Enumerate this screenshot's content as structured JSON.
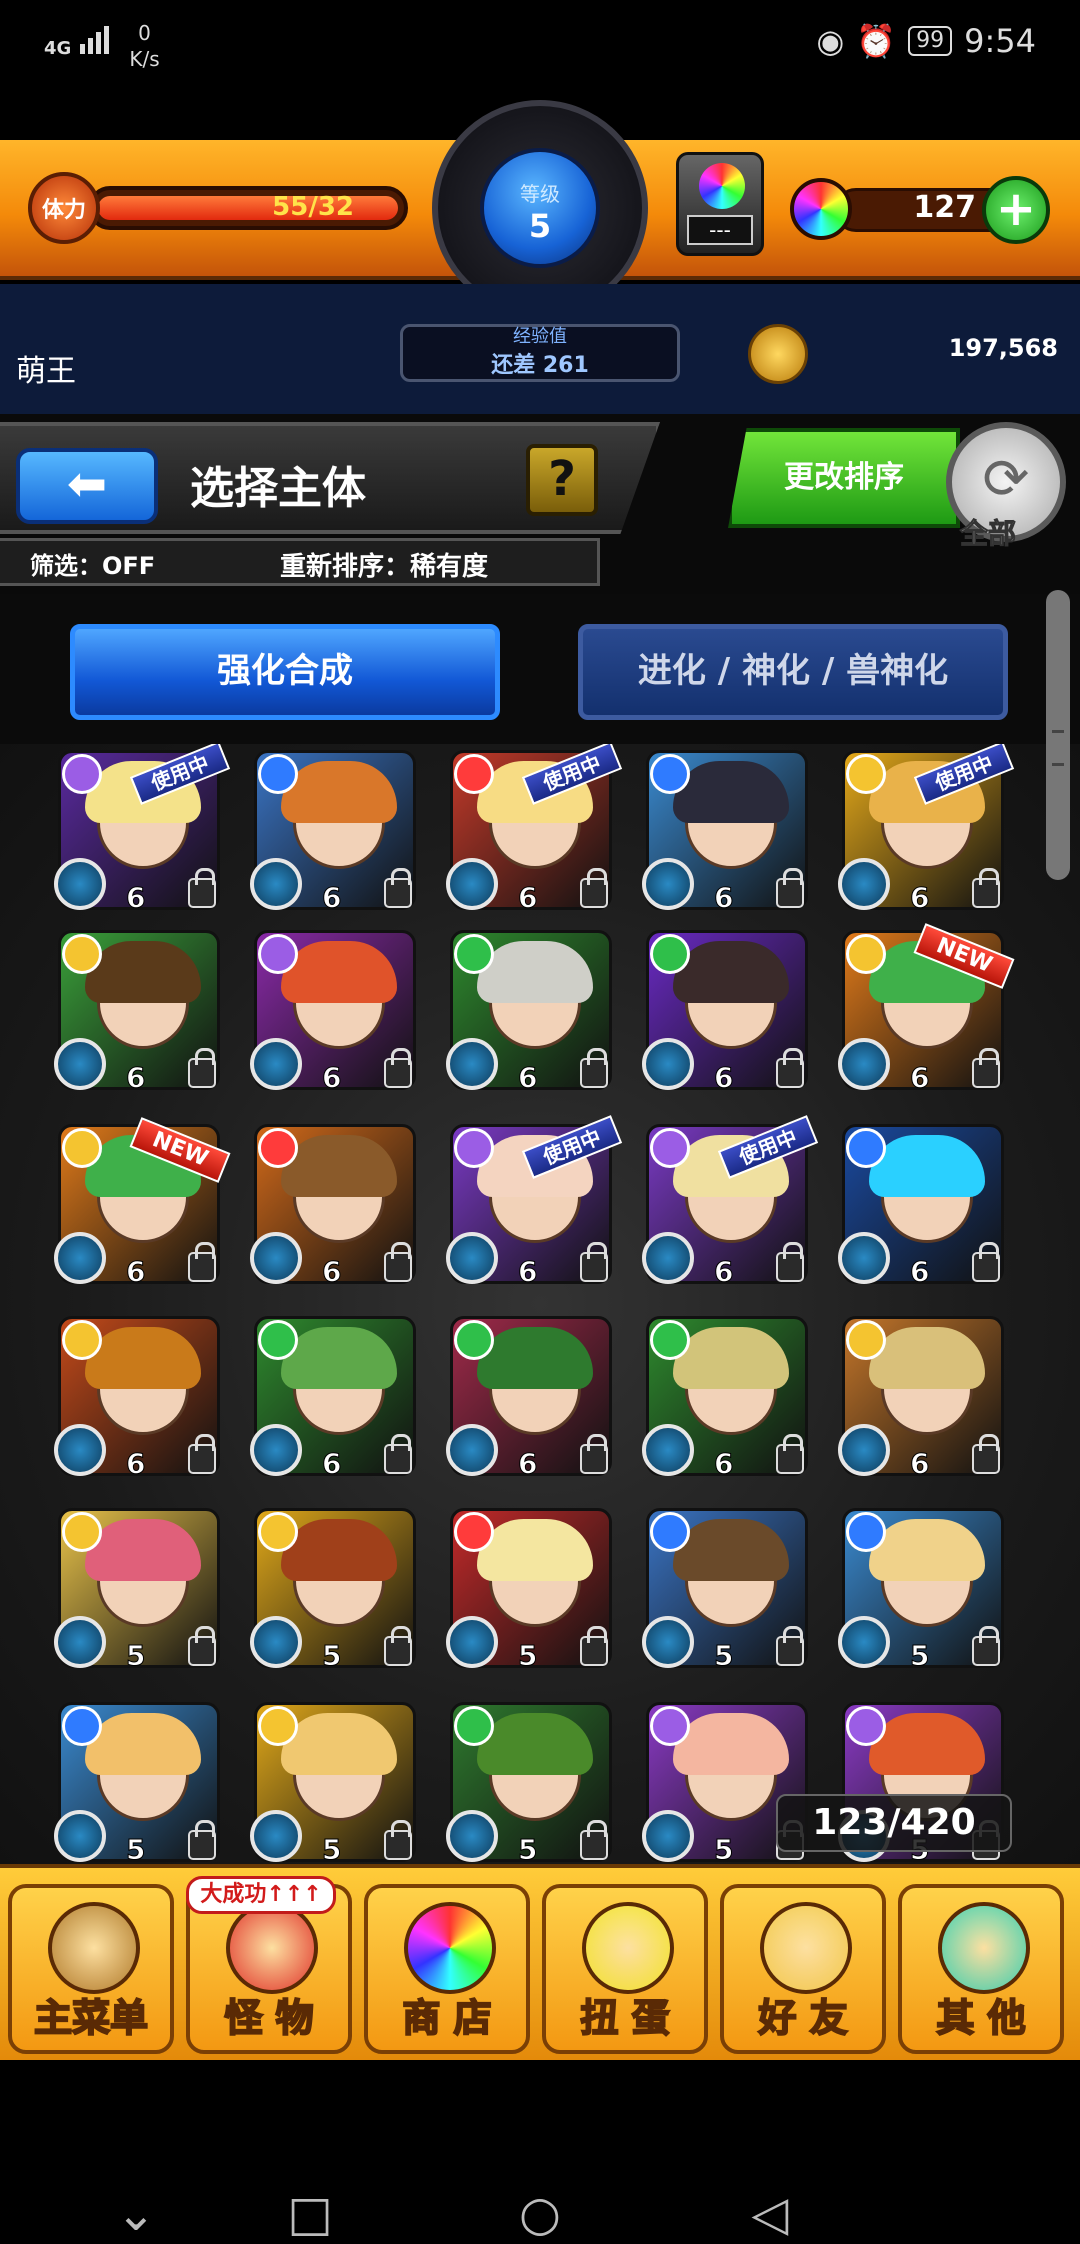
{
  "status_bar": {
    "network": "4G",
    "speed_value": "0",
    "speed_unit": "K/s",
    "battery": "99",
    "time": "9:54"
  },
  "header": {
    "stamina_label": "体力",
    "stamina": "55/32",
    "stamina_fraction": 1.0,
    "level_label": "等级",
    "level": "5",
    "gem_box": "---",
    "orb_count": "127",
    "plus": "+"
  },
  "info_strip": {
    "username": "萌王",
    "exp_label": "经验值",
    "exp_remaining": "还差 261",
    "coins": "197,568"
  },
  "title_row": {
    "back": "⬅",
    "title": "选择主体",
    "help": "?",
    "filter": "筛选：OFF",
    "sort": "重新排序：稀有度",
    "sort_change": "更改排序",
    "refresh": "⟳",
    "all": "全部"
  },
  "tabs": {
    "active": "强化合成",
    "inactive": "进化 / 神化 / 兽神化"
  },
  "monsters": [
    {
      "rarity": "6",
      "tag": "使用中",
      "element": "#9b5de5",
      "hair": "#f4e28a",
      "bg": "#5a2aa0"
    },
    {
      "rarity": "6",
      "tag": "",
      "element": "#2f7bff",
      "hair": "#d9772a",
      "bg": "#3a74c4"
    },
    {
      "rarity": "6",
      "tag": "使用中",
      "element": "#ff3b3b",
      "hair": "#f7dc84",
      "bg": "#c43a2a"
    },
    {
      "rarity": "6",
      "tag": "",
      "element": "#2f7bff",
      "hair": "#2a2a3a",
      "bg": "#3a8ad0"
    },
    {
      "rarity": "6",
      "tag": "使用中",
      "element": "#f4c430",
      "hair": "#e9b24a",
      "bg": "#e3a81a"
    },
    {
      "rarity": "6",
      "tag": "",
      "element": "#f4c430",
      "hair": "#5a3a1a",
      "bg": "#3aa03a"
    },
    {
      "rarity": "6",
      "tag": "",
      "element": "#9b5de5",
      "hair": "#e0532a",
      "bg": "#8a2aa8"
    },
    {
      "rarity": "6",
      "tag": "",
      "element": "#2fbf4a",
      "hair": "#cfcfc8",
      "bg": "#2e8a2e"
    },
    {
      "rarity": "6",
      "tag": "",
      "element": "#2fbf4a",
      "hair": "#3a2a2a",
      "bg": "#6a2ac4"
    },
    {
      "rarity": "6",
      "tag": "NEW",
      "element": "#f4c430",
      "hair": "#3fb04a",
      "bg": "#e07a1a"
    },
    {
      "rarity": "6",
      "tag": "NEW",
      "element": "#f4c430",
      "hair": "#3fb04a",
      "bg": "#e07a1a"
    },
    {
      "rarity": "6",
      "tag": "",
      "element": "#ff3b3b",
      "hair": "#8a5a2a",
      "bg": "#d26a1a"
    },
    {
      "rarity": "6",
      "tag": "使用中",
      "element": "#9b5de5",
      "hair": "#f4d4c0",
      "bg": "#7a3ac4"
    },
    {
      "rarity": "6",
      "tag": "使用中",
      "element": "#9b5de5",
      "hair": "#f0e0a0",
      "bg": "#7a3ac4"
    },
    {
      "rarity": "6",
      "tag": "",
      "element": "#2f7bff",
      "hair": "#2ad0ff",
      "bg": "#1a4aa0"
    },
    {
      "rarity": "6",
      "tag": "",
      "element": "#f4c430",
      "hair": "#c97a1a",
      "bg": "#c44a1a"
    },
    {
      "rarity": "6",
      "tag": "",
      "element": "#2fbf4a",
      "hair": "#5ea84a",
      "bg": "#2e8a2e"
    },
    {
      "rarity": "6",
      "tag": "",
      "element": "#2fbf4a",
      "hair": "#2e7a2e",
      "bg": "#a02a4a"
    },
    {
      "rarity": "6",
      "tag": "",
      "element": "#2fbf4a",
      "hair": "#d2c47a",
      "bg": "#2e8a2e"
    },
    {
      "rarity": "6",
      "tag": "",
      "element": "#f4c430",
      "hair": "#d9c07a",
      "bg": "#c4762a"
    },
    {
      "rarity": "5",
      "tag": "",
      "element": "#f4c430",
      "hair": "#e0607a",
      "bg": "#e8c24a"
    },
    {
      "rarity": "5",
      "tag": "",
      "element": "#f4c430",
      "hair": "#a0401a",
      "bg": "#e0a81a"
    },
    {
      "rarity": "5",
      "tag": "",
      "element": "#ff3b3b",
      "hair": "#f4e6a0",
      "bg": "#c42a2a"
    },
    {
      "rarity": "5",
      "tag": "",
      "element": "#2f7bff",
      "hair": "#6a4a2a",
      "bg": "#3a74c4"
    },
    {
      "rarity": "5",
      "tag": "",
      "element": "#2f7bff",
      "hair": "#f0d28a",
      "bg": "#3a8ad0"
    },
    {
      "rarity": "5",
      "tag": "",
      "element": "#2f7bff",
      "hair": "#f2c06a",
      "bg": "#3a8ad0"
    },
    {
      "rarity": "5",
      "tag": "",
      "element": "#f4c430",
      "hair": "#f0c870",
      "bg": "#e0a81a"
    },
    {
      "rarity": "5",
      "tag": "",
      "element": "#2fbf4a",
      "hair": "#4a8a2a",
      "bg": "#2e7a2e"
    },
    {
      "rarity": "5",
      "tag": "",
      "element": "#9b5de5",
      "hair": "#f4b6a0",
      "bg": "#8a3ac4"
    },
    {
      "rarity": "5",
      "tag": "",
      "element": "#9b5de5",
      "hair": "#e05a2a",
      "bg": "#8a3ac4"
    }
  ],
  "box_counter": "123/420",
  "bottom_menu": {
    "items": [
      {
        "label": "主菜单",
        "icon": "castle-gate-icon",
        "color": "#b07a2a"
      },
      {
        "label": "怪 物",
        "icon": "monster-icon",
        "color": "#e0332a"
      },
      {
        "label": "商 店",
        "icon": "rainbow-orb-icon",
        "color": "#ffffff"
      },
      {
        "label": "扭 蛋",
        "icon": "egg-icon",
        "color": "#f2e22a"
      },
      {
        "label": "好 友",
        "icon": "friends-icon",
        "color": "#f2c84a"
      },
      {
        "label": "其 他",
        "icon": "other-icon",
        "color": "#3acfb0"
      }
    ],
    "badge": "大成功↑↑↑"
  },
  "nav": {
    "back": "◁",
    "home": "○",
    "recent": "□",
    "down": "⌄"
  }
}
